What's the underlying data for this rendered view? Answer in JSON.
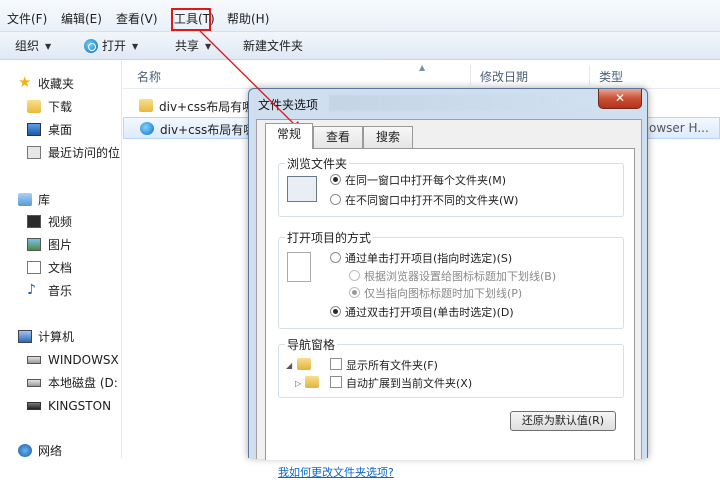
{
  "menu": {
    "file": "文件(F)",
    "edit": "编辑(E)",
    "view": "查看(V)",
    "tools": "工具(T)",
    "help": "帮助(H)"
  },
  "toolbar": {
    "organize": "组织",
    "open": "打开",
    "share": "共享",
    "new_folder": "新建文件夹"
  },
  "nav": {
    "favorites": "收藏夹",
    "downloads": "下载",
    "desktop": "桌面",
    "recent": "最近访问的位",
    "libraries": "库",
    "videos": "视频",
    "pictures": "图片",
    "documents": "文档",
    "music": "音乐",
    "computer": "计算机",
    "windows_drive": "WINDOWSX",
    "local_disk": "本地磁盘 (D:",
    "kingston": "KINGSTON",
    "network": "网络"
  },
  "columns": {
    "name": "名称",
    "modified": "修改日期",
    "type": "类型"
  },
  "files": [
    {
      "name": "div+css布局有哪",
      "type": "",
      "icon": "folder-icon"
    },
    {
      "name": "div+css布局有哪",
      "type": "owser H...",
      "icon": "browser-file-icon"
    }
  ],
  "dialog": {
    "title": "文件夹选项",
    "close_symbol": "✕",
    "tabs": [
      "常规",
      "查看",
      "搜索"
    ],
    "browse_group": {
      "title": "浏览文件夹",
      "options": [
        "在同一窗口中打开每个文件夹(M)",
        "在不同窗口中打开不同的文件夹(W)"
      ]
    },
    "click_group": {
      "title": "打开项目的方式",
      "single_click": "通过单击打开项目(指向时选定)(S)",
      "underline_browser": "根据浏览器设置给图标标题加下划线(B)",
      "underline_hover": "仅当指向图标标题时加下划线(P)",
      "double_click": "通过双击打开项目(单击时选定)(D)"
    },
    "nav_group": {
      "title": "导航窗格",
      "show_all": "显示所有文件夹(F)",
      "auto_expand": "自动扩展到当前文件夹(X)"
    },
    "restore_button": "还原为默认值(R)",
    "help_link": "我如何更改文件夹选项?"
  },
  "colors": {
    "highlight_box": "#e01818",
    "annotation_arrow": "#d91a1a",
    "dialog_frame": "#cfdff0",
    "link": "#0a66cc"
  }
}
